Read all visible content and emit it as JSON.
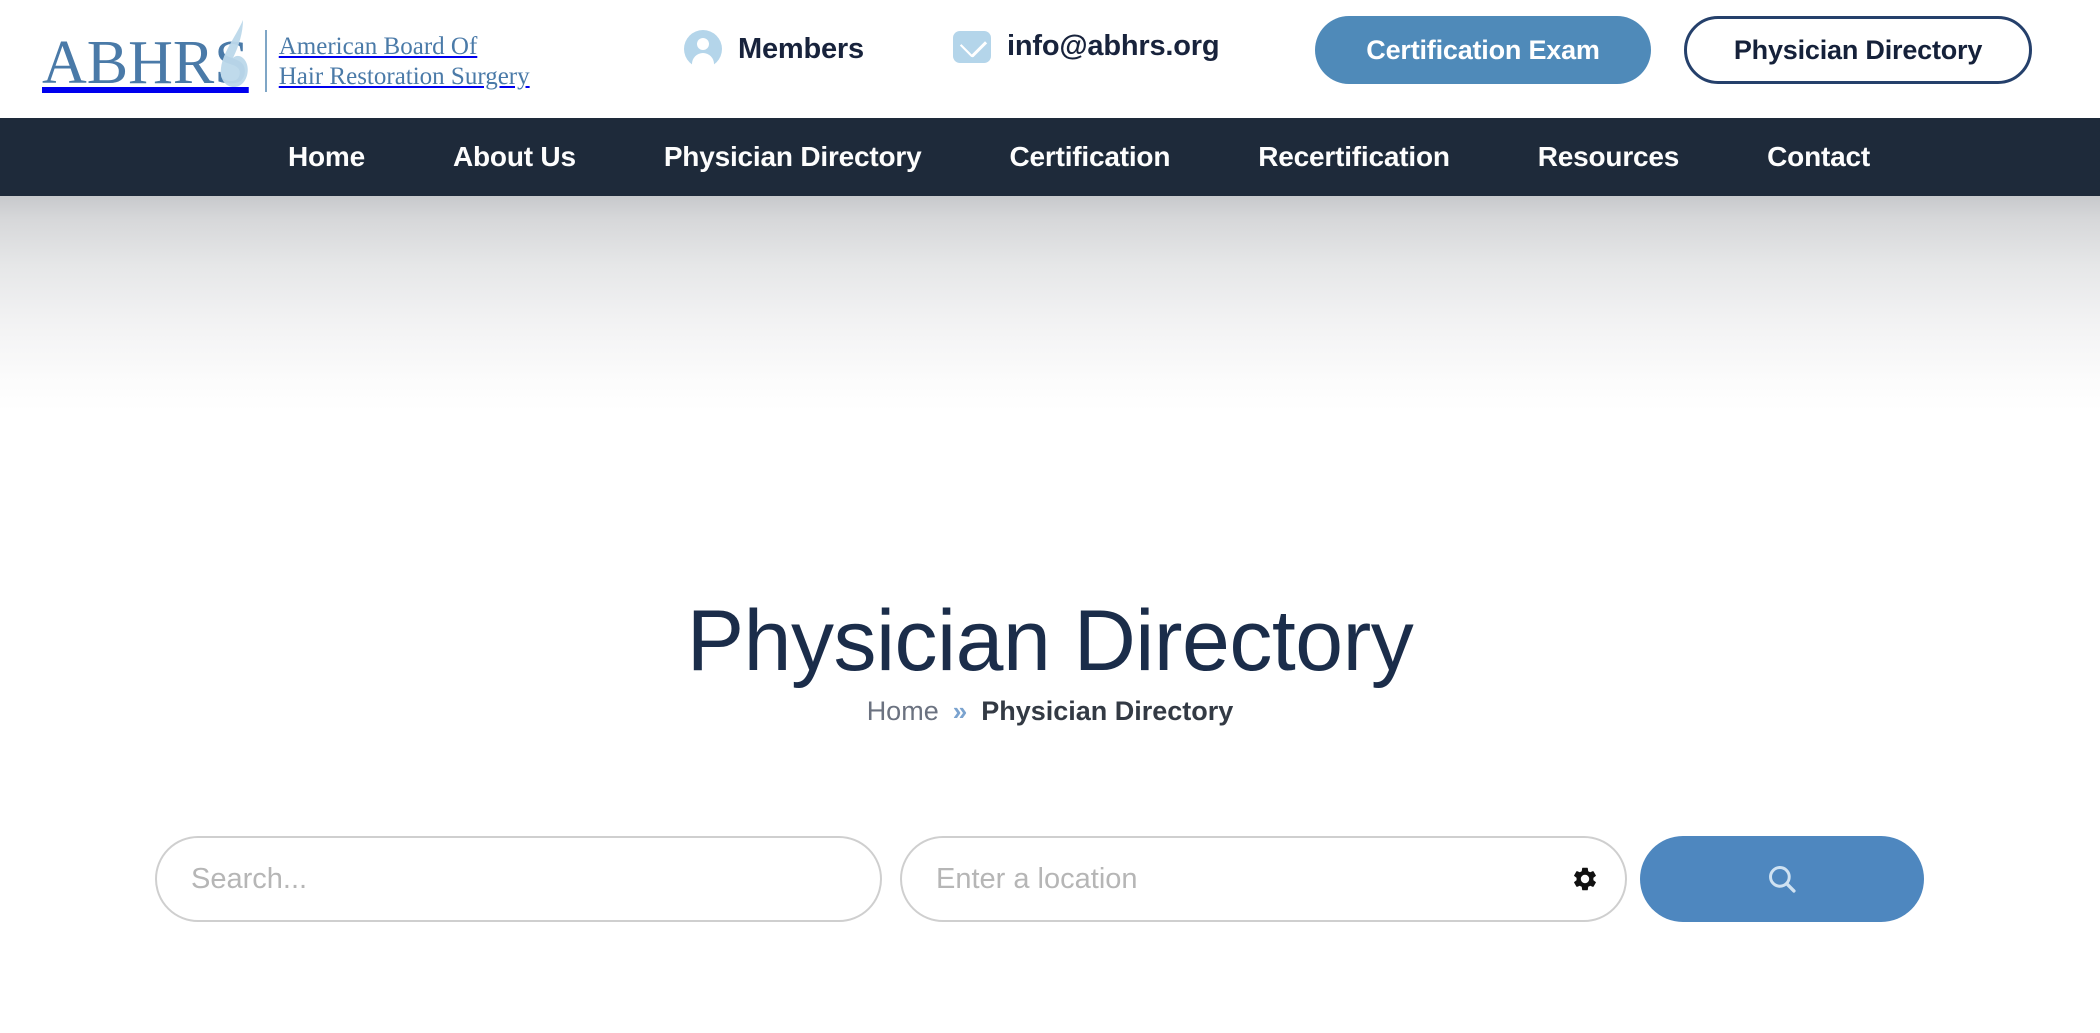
{
  "header": {
    "logo": {
      "mark": "ABHRS",
      "line1": "American Board Of",
      "line2": "Hair Restoration Surgery",
      "swoosh_icon": "hair-strand-icon",
      "brand_color": "#4a7aa8"
    },
    "utility_links": [
      {
        "label": "Members",
        "icon": "user-circle-icon"
      },
      {
        "label": "info@abhrs.org",
        "icon": "envelope-icon"
      }
    ],
    "buttons": [
      {
        "label": "Certification Exam",
        "style": "filled",
        "bg": "#4f8ab9",
        "color": "#ffffff"
      },
      {
        "label": "Physician Directory",
        "style": "outline",
        "border": "#25406b",
        "color": "#15213a"
      }
    ]
  },
  "nav": {
    "background": "#1e2a3a",
    "items": [
      {
        "label": "Home"
      },
      {
        "label": "About Us"
      },
      {
        "label": "Physician Directory"
      },
      {
        "label": "Certification"
      },
      {
        "label": "Recertification"
      },
      {
        "label": "Resources"
      },
      {
        "label": "Contact"
      }
    ]
  },
  "hero": {
    "title": "Physician Directory",
    "title_color": "#1b2d4a",
    "breadcrumb": {
      "home": "Home",
      "separator": "»",
      "current": "Physician Directory"
    }
  },
  "search": {
    "keyword": {
      "value": "",
      "placeholder": "Search..."
    },
    "location": {
      "value": "",
      "placeholder": "Enter a location",
      "settings_icon": "gear-icon"
    },
    "submit": {
      "icon": "search-icon",
      "bg": "#4e87bf"
    }
  }
}
